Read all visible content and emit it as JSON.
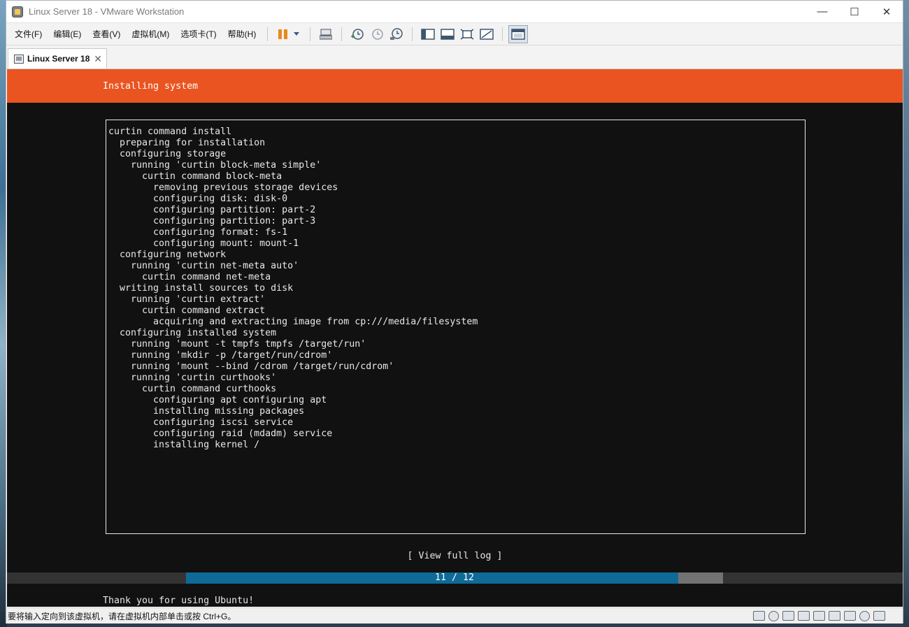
{
  "window": {
    "title": "Linux Server 18 - VMware Workstation",
    "controls": {
      "minimize": "—",
      "maximize": "☐",
      "close": "✕"
    }
  },
  "menu": [
    "文件(F)",
    "编辑(E)",
    "查看(V)",
    "虚拟机(M)",
    "选项卡(T)",
    "帮助(H)"
  ],
  "toolbar_icons": [
    "pause-icon",
    "send-ctrl-alt-del-icon",
    "snapshot-icon",
    "revert-snapshot-icon",
    "snapshot-manager-icon",
    "show-library-icon",
    "thumbnail-icon",
    "fullscreen-icon",
    "unity-icon",
    "console-view-icon"
  ],
  "tab": {
    "label": "Linux Server 18",
    "close": "✕"
  },
  "installer": {
    "header": "Installing system",
    "log_lines": [
      "curtin command install",
      "  preparing for installation",
      "  configuring storage",
      "    running 'curtin block-meta simple'",
      "      curtin command block-meta",
      "        removing previous storage devices",
      "        configuring disk: disk-0",
      "        configuring partition: part-2",
      "        configuring partition: part-3",
      "        configuring format: fs-1",
      "        configuring mount: mount-1",
      "  configuring network",
      "    running 'curtin net-meta auto'",
      "      curtin command net-meta",
      "  writing install sources to disk",
      "    running 'curtin extract'",
      "      curtin command extract",
      "        acquiring and extracting image from cp:///media/filesystem",
      "  configuring installed system",
      "    running 'mount -t tmpfs tmpfs /target/run'",
      "    running 'mkdir -p /target/run/cdrom'",
      "    running 'mount --bind /cdrom /target/run/cdrom'",
      "    running 'curtin curthooks'",
      "      curtin command curthooks",
      "        configuring apt configuring apt",
      "        installing missing packages",
      "        configuring iscsi service",
      "        configuring raid (mdadm) service",
      "        installing kernel /"
    ],
    "view_log_button": "[ View full log ]",
    "progress": {
      "text": "11 / 12",
      "current": 11,
      "total": 12,
      "fill_fraction": 0.917
    },
    "footer": "Thank you for using Ubuntu!"
  },
  "status": {
    "text": "要将输入定向到该虚拟机，请在虚拟机内部单击或按 Ctrl+G。",
    "icons": [
      "hard-disk-icon",
      "cd-icon",
      "network-icon",
      "usb-icon",
      "sound-icon",
      "printer-icon",
      "display-icon",
      "bluetooth-icon",
      "message-icon",
      "resize-grip-icon"
    ]
  },
  "colors": {
    "ubuntu_orange": "#e95420",
    "console_bg": "#111111",
    "progress_fill": "#0e6b98",
    "progress_track": "#727272"
  }
}
